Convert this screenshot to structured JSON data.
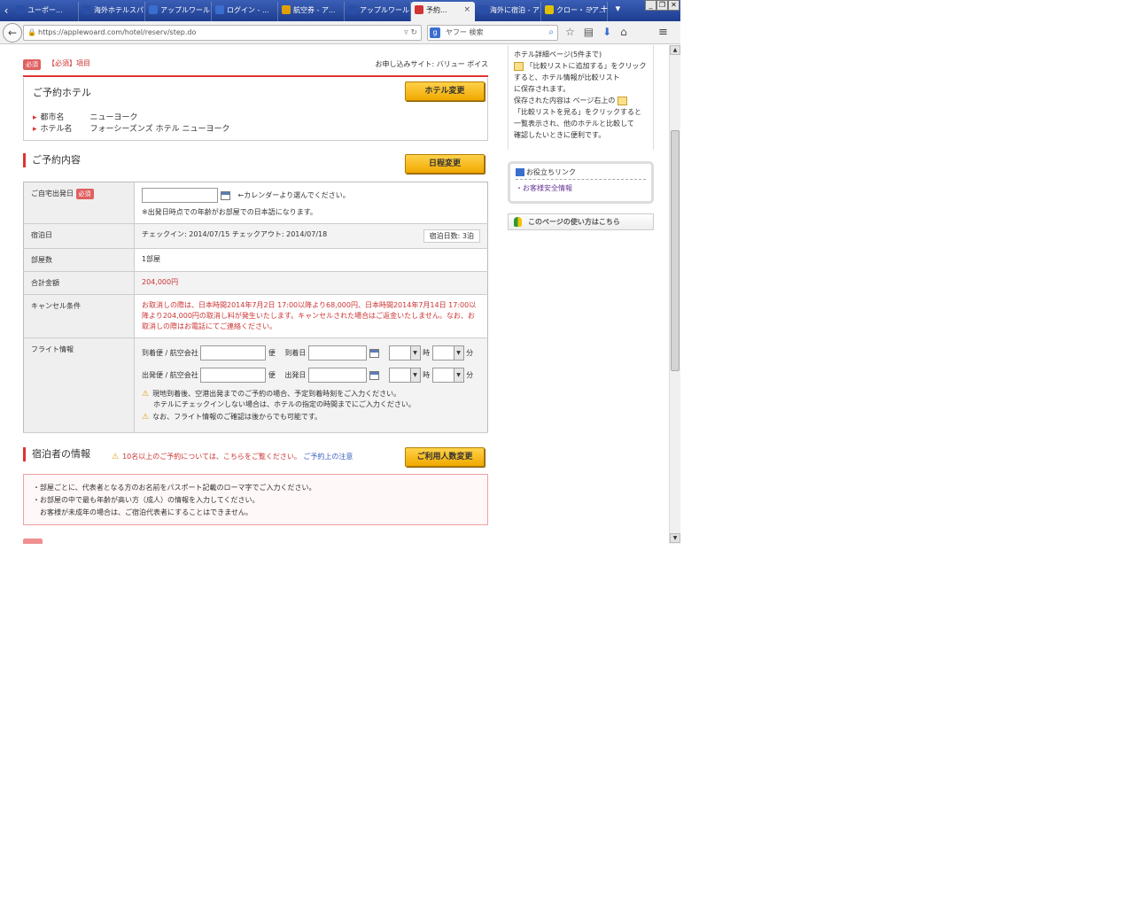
{
  "browser": {
    "tabs": [
      {
        "label": "ユーポー...",
        "active": false,
        "color": "#2a4fa8"
      },
      {
        "label": "海外ホテルスパ...",
        "active": false,
        "color": "#2a4fa8"
      },
      {
        "label": "アップルワール...",
        "active": false,
        "color": "#3a6ecf"
      },
      {
        "label": "ログイン - ...",
        "active": false,
        "color": "#3a6ecf"
      },
      {
        "label": "航空券 - ア...",
        "active": false,
        "color": "#e0a000"
      },
      {
        "label": "アップルワールド...",
        "active": false,
        "color": "#2a4fa8"
      },
      {
        "label": "予約...",
        "active": true,
        "color": "#d33333"
      },
      {
        "label": "海外に宿泊 - ア...",
        "active": false,
        "color": "#2a4fa8"
      },
      {
        "label": "クロー・ミア...",
        "active": false,
        "color": "#e0c000"
      }
    ],
    "url": "https://applewoard.com/hotel/reserv/step.do",
    "search_placeholder": "ヤフー 検索"
  },
  "header": {
    "required_badge": "必須",
    "required_text": "【必須】項目",
    "plan": "お申し込みサイト: バリュー ボイス"
  },
  "hotel": {
    "title": "ご予約ホテル",
    "change_button": "ホテル変更",
    "city_label": "都市名",
    "city_value": "ニューヨーク",
    "hotel_label": "ホテル名",
    "hotel_value": "フォーシーズンズ ホテル ニューヨーク"
  },
  "booking": {
    "title": "ご予約内容",
    "change_button": "日程変更",
    "departure_label": "ご自宅出発日",
    "departure_badge": "必須",
    "departure_hint": "←カレンダーより選んでください。",
    "departure_note": "※出発日時点での年齢がお部屋での日本語になります。",
    "stay_label": "宿泊日",
    "stay_value": "チェックイン: 2014/07/15  チェックアウト: 2014/07/18",
    "nights": "宿泊日数: 3泊",
    "rooms_label": "部屋数",
    "rooms_value": "1部屋",
    "total_label": "合計金額",
    "total_value": "204,000円",
    "cancel_label": "キャンセル条件",
    "cancel_value": "お取消しの際は、日本時間2014年7月2日 17:00以降より68,000円、日本時間2014年7月14日 17:00以降より204,000円の取消し料が発生いたします。キャンセルされた場合はご返金いたしません。なお、お取消しの際はお電話にてご連絡ください。",
    "flight_label": "フライト情報",
    "flight_arrival_label": "到着便 / 航空会社",
    "flight_arrival_date_label": "到着日",
    "flight_departure_label": "出発便 / 航空会社",
    "flight_departure_date_label": "出発日",
    "flight_flight_unit": "便",
    "flight_hour_unit": "時",
    "flight_minute_unit": "分",
    "flight_warn1": "現地到着後、空港出発までのご予約の場合、予定到着時刻をご入力ください。",
    "flight_warn1b": "ホテルにチェックインしない場合は、ホテルの指定の時間までにご入力ください。",
    "flight_warn2": "なお、フライト情報のご確認は後からでも可能です。"
  },
  "guest": {
    "title": "宿泊者の情報",
    "warn_text": "10名以上のご予約については、こちらをご覧ください。",
    "warn_link": "ご予約上の注意",
    "change_button": "ご利用人数変更",
    "notes": [
      "・部屋ごとに、代表者となる方のお名前をパスポート記載のローマ字でご入力ください。",
      "・お部屋の中で最も年齢が高い方（成人）の情報を入力してください。",
      "　お客様が未成年の場合は、ご宿泊代表者にすることはできません。"
    ]
  },
  "sidebar": {
    "howto_lines": [
      "ホテル詳細ページ(5件まで)",
      "「比較リストに追加する」をクリック",
      "すると、ホテル情報が比較リスト",
      "に保存されます。",
      "保存された内容は",
      "「比較リストを見る」をクリックすると",
      "一覧表示され、他のホテルと比較して",
      "確認したいときに便利です。"
    ],
    "howto_memo": "ページ右上の",
    "quick_title": "お役立ちリンク",
    "quick_link": "・お客様安全情報",
    "howto_button": "このページの使い方はこちら"
  },
  "colors": {
    "accent_red": "#d33333",
    "button_orange": "#f0a800",
    "link_purple": "#6a3a9a"
  }
}
